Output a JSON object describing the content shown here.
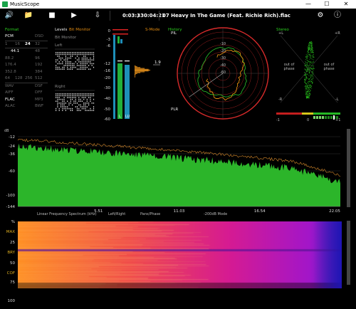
{
  "window": {
    "title": "MusicScope",
    "minimize": "—",
    "maximize": "☐",
    "close": "✕"
  },
  "toolbar": {
    "volume_icon": "volume-icon",
    "open_icon": "folder-icon",
    "stop_icon": "stop-icon",
    "play_icon": "play-icon",
    "export_icon": "export-icon",
    "elapsed": "0:03:33",
    "separator": "/",
    "total": "0:04:21",
    "track": "07 Heavy In The Game (Feat. Richie Rich).flac",
    "settings_icon": "gear-icon",
    "info_icon": "info-icon"
  },
  "format_panel": {
    "title": "Format",
    "rows": [
      {
        "left": "PCM",
        "right": "DSD"
      },
      {
        "cells": [
          "1",
          "16",
          "24",
          "32"
        ]
      },
      {
        "left": "44.1",
        "right": "48"
      },
      {
        "left": "88.2",
        "right": "96"
      },
      {
        "left": "176.4",
        "right": "192"
      },
      {
        "left": "352.8",
        "right": "384"
      },
      {
        "cells": [
          "64",
          "128",
          "256",
          "512"
        ]
      },
      {
        "left": "WAV",
        "right": "DSF"
      },
      {
        "left": "AIFF",
        "right": "DFF"
      },
      {
        "left": "FLAC",
        "right": "MP3"
      },
      {
        "left": "ALAC",
        "right": "BWF"
      }
    ]
  },
  "levels_panel": {
    "title": "Levels",
    "subtitle": "Bit Monitor",
    "bit_monitor_label": "Bit Monitor",
    "left_label": "Left",
    "right_label": "Right",
    "smode_label": "S-Mode",
    "scale": [
      "0",
      "-3",
      "-6",
      "-12",
      "-16",
      "-20",
      "-30",
      "-40",
      "-50",
      "-60"
    ],
    "channel_labels": [
      "L",
      "LU"
    ],
    "peak_value": "1.9",
    "colors": {
      "bar": "#1e8fb8",
      "meter_fill": "#22b03a"
    }
  },
  "history_panel": {
    "title": "History",
    "pl_label": "PlL",
    "plr_label": "PLR",
    "ring_labels": [
      "-10",
      "-20",
      "-30",
      "-40",
      "-60"
    ]
  },
  "stereo_panel": {
    "title": "Stereo",
    "corner_plus_l": "+L",
    "corner_plus_r": "+R",
    "corner_minus_l": "-L",
    "corner_minus_r": "-R",
    "out_of_phase_left": "out of phase",
    "out_of_phase_right": "out of phase",
    "phase_min": "-1",
    "phase_zero": "0",
    "phase_max": "+1"
  },
  "spectrum_panel": {
    "y_unit": "dB",
    "y_ticks": [
      "-12",
      "-24",
      "-36",
      "-60",
      "-100",
      "-144"
    ],
    "x_ticks": [
      "5.51",
      "11.03",
      "16.54",
      "22.05"
    ],
    "label": "Linear Frequency Spectrum (kHz)",
    "modes": [
      "Left/Right",
      "Pans/Phase",
      "-200dB Mode"
    ],
    "colors": {
      "fill": "#2cb52a",
      "peak": "#d2872a"
    }
  },
  "spectrogram_panel": {
    "y_ticks": [
      "%",
      "MAX",
      "25",
      "BRY",
      "50",
      "COF",
      "75",
      "100"
    ],
    "colors": {
      "hot": "#f36a1c",
      "mid": "#d61b92",
      "cool": "#4424c9"
    }
  }
}
